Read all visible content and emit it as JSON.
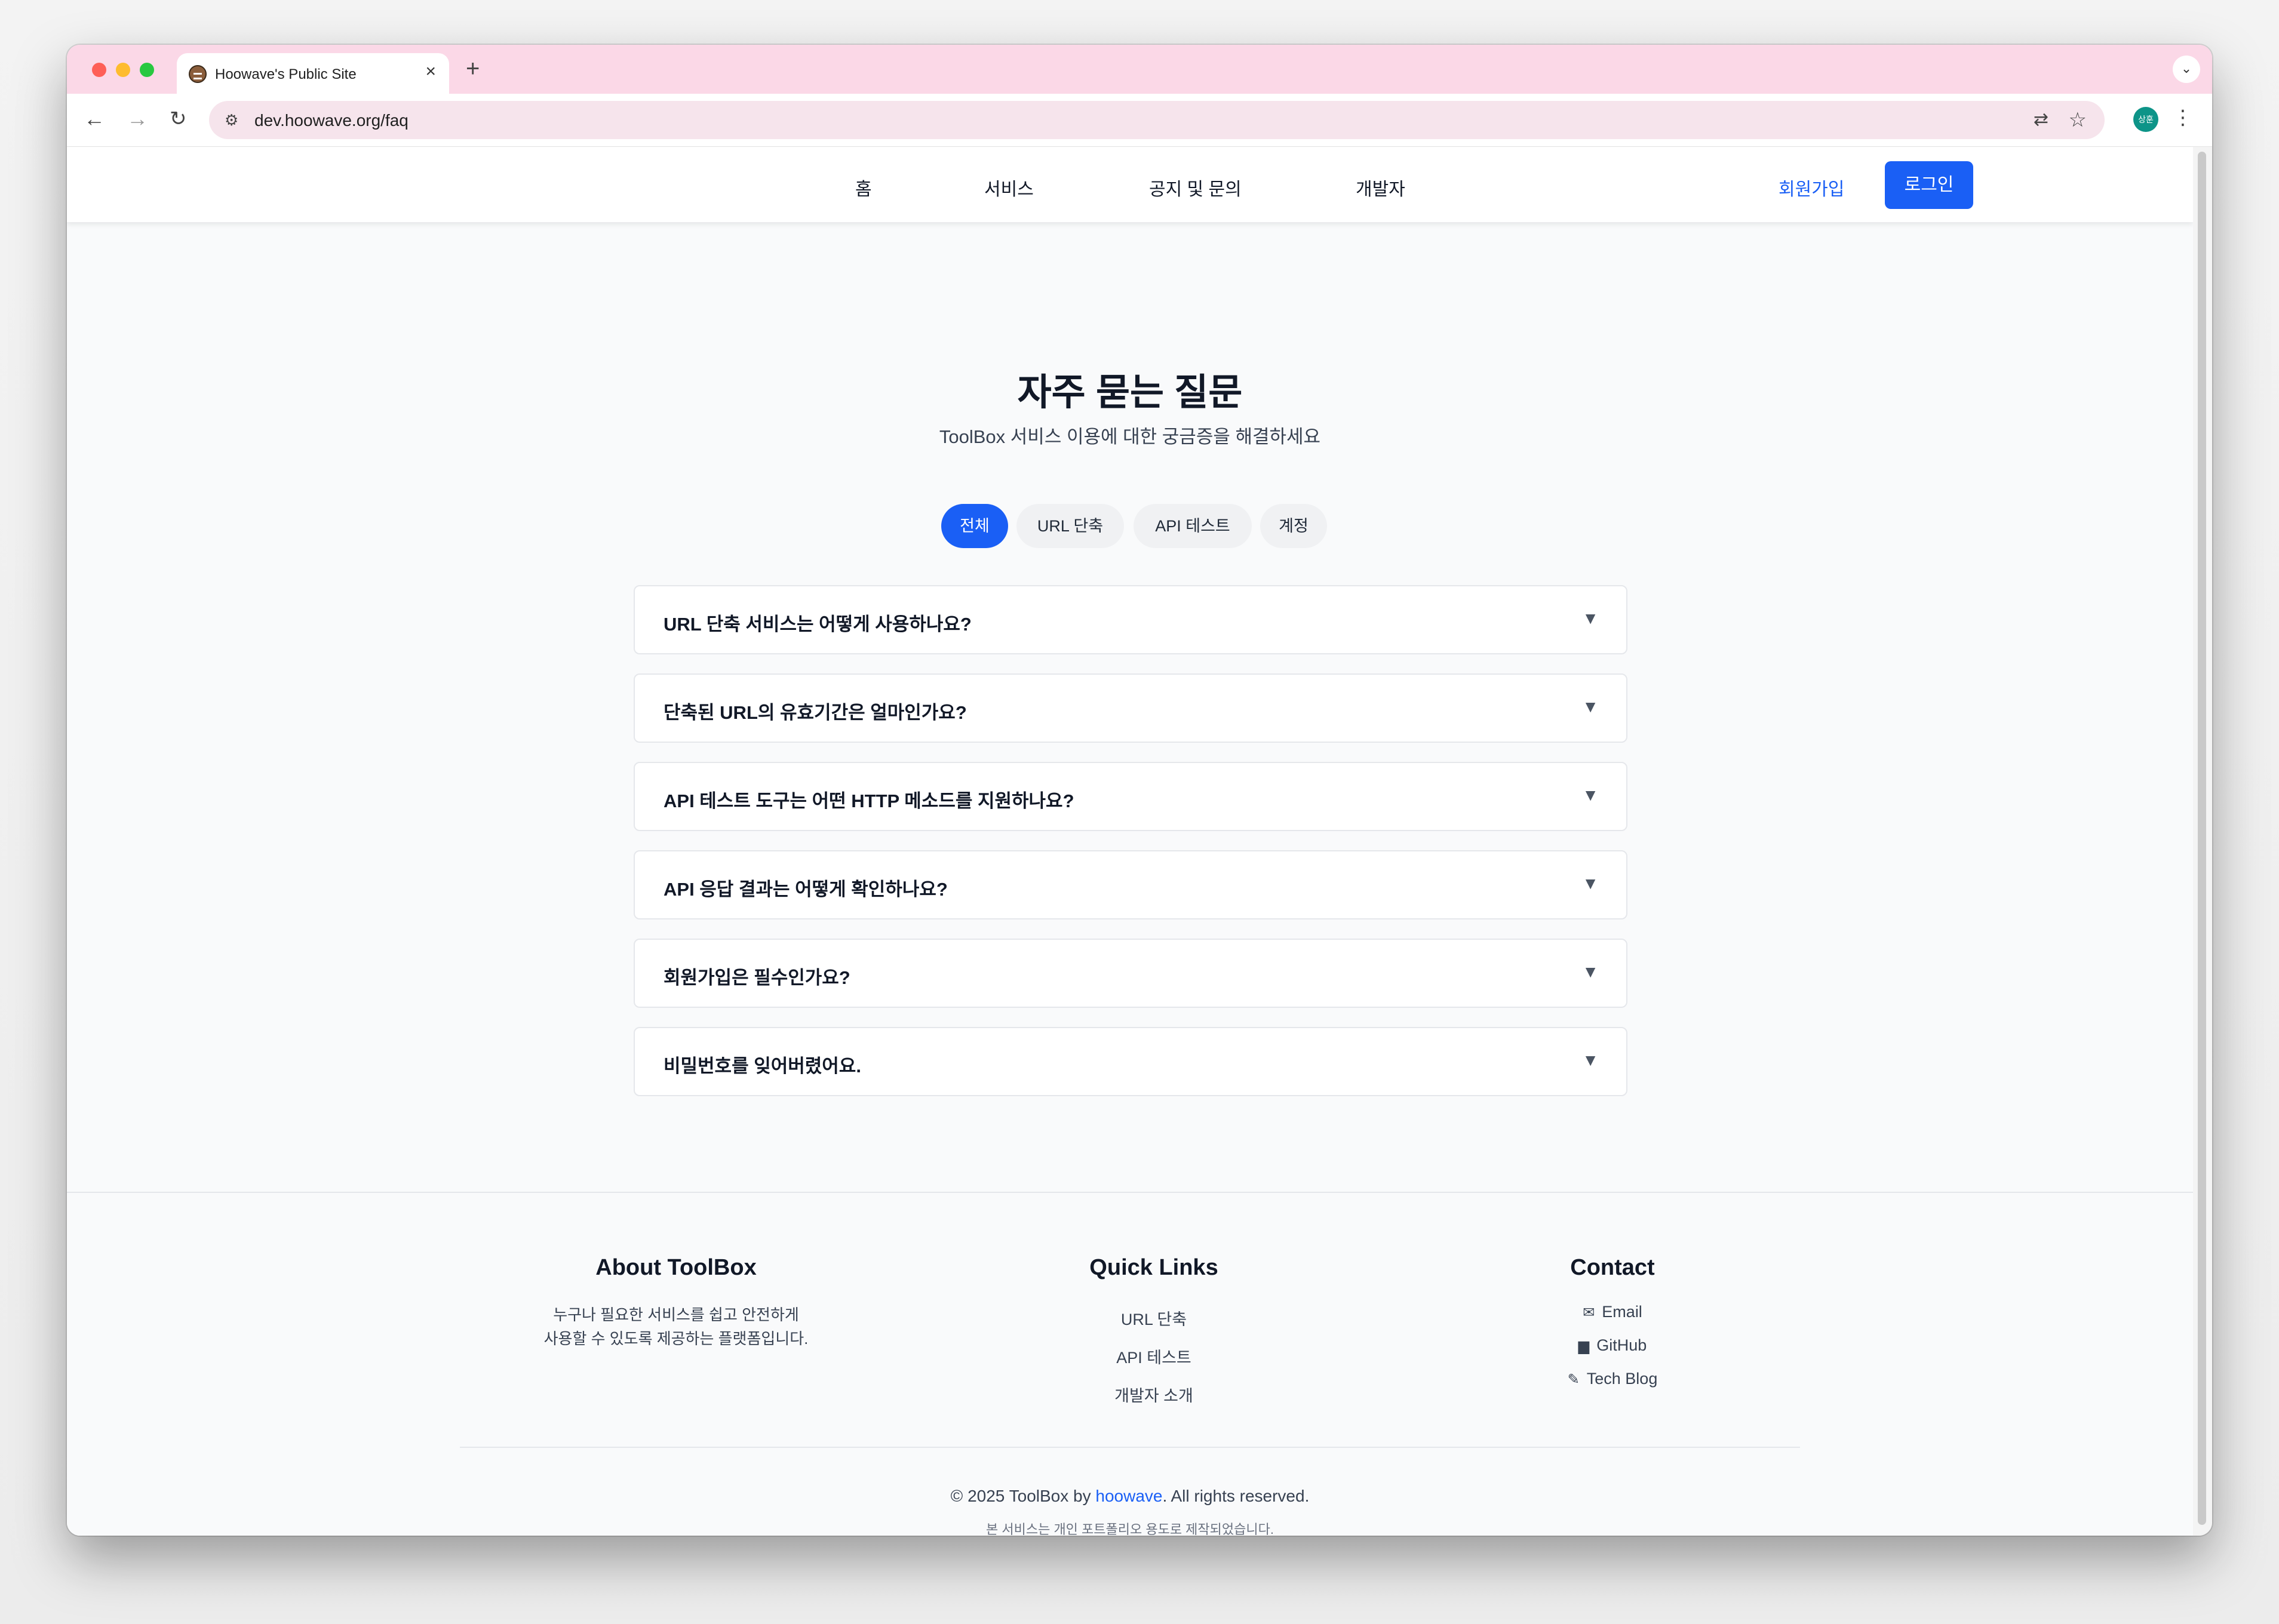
{
  "browser": {
    "tab_title": "Hoowave's Public Site",
    "url": "dev.hoowave.org/faq",
    "profile_initials": "상훈"
  },
  "header": {
    "nav": [
      "홈",
      "서비스",
      "공지 및 문의",
      "개발자"
    ],
    "signup": "회원가입",
    "login": "로그인"
  },
  "hero": {
    "title": "자주 묻는 질문",
    "subtitle": "ToolBox 서비스 이용에 대한 궁금증을 해결하세요"
  },
  "categories": {
    "selected": "전체",
    "items": [
      "전체",
      "URL 단축",
      "API 테스트",
      "계정"
    ]
  },
  "faq": [
    "URL 단축 서비스는 어떻게 사용하나요?",
    "단축된 URL의 유효기간은 얼마인가요?",
    "API 테스트 도구는 어떤 HTTP 메소드를 지원하나요?",
    "API 응답 결과는 어떻게 확인하나요?",
    "회원가입은 필수인가요?",
    "비밀번호를 잊어버렸어요."
  ],
  "footer": {
    "about_title": "About ToolBox",
    "about_line1": "누구나 필요한 서비스를 쉽고 안전하게",
    "about_line2": "사용할 수 있도록 제공하는 플랫폼입니다.",
    "links_title": "Quick Links",
    "links": [
      "URL 단축",
      "API 테스트",
      "개발자 소개"
    ],
    "contact_title": "Contact",
    "contact": [
      {
        "icon": "email-icon",
        "label": "Email"
      },
      {
        "icon": "github-icon",
        "label": "GitHub"
      },
      {
        "icon": "blog-icon",
        "label": "Tech Blog"
      }
    ],
    "copyright_prefix": "© 2025 ToolBox by ",
    "copyright_link": "hoowave",
    "copyright_suffix": ". All rights reserved.",
    "note": "본 서비스는 개인 포트폴리오 용도로 제작되었습니다."
  },
  "colors": {
    "accent": "#1a5ff5",
    "tabstrip": "#fbd8e7"
  }
}
